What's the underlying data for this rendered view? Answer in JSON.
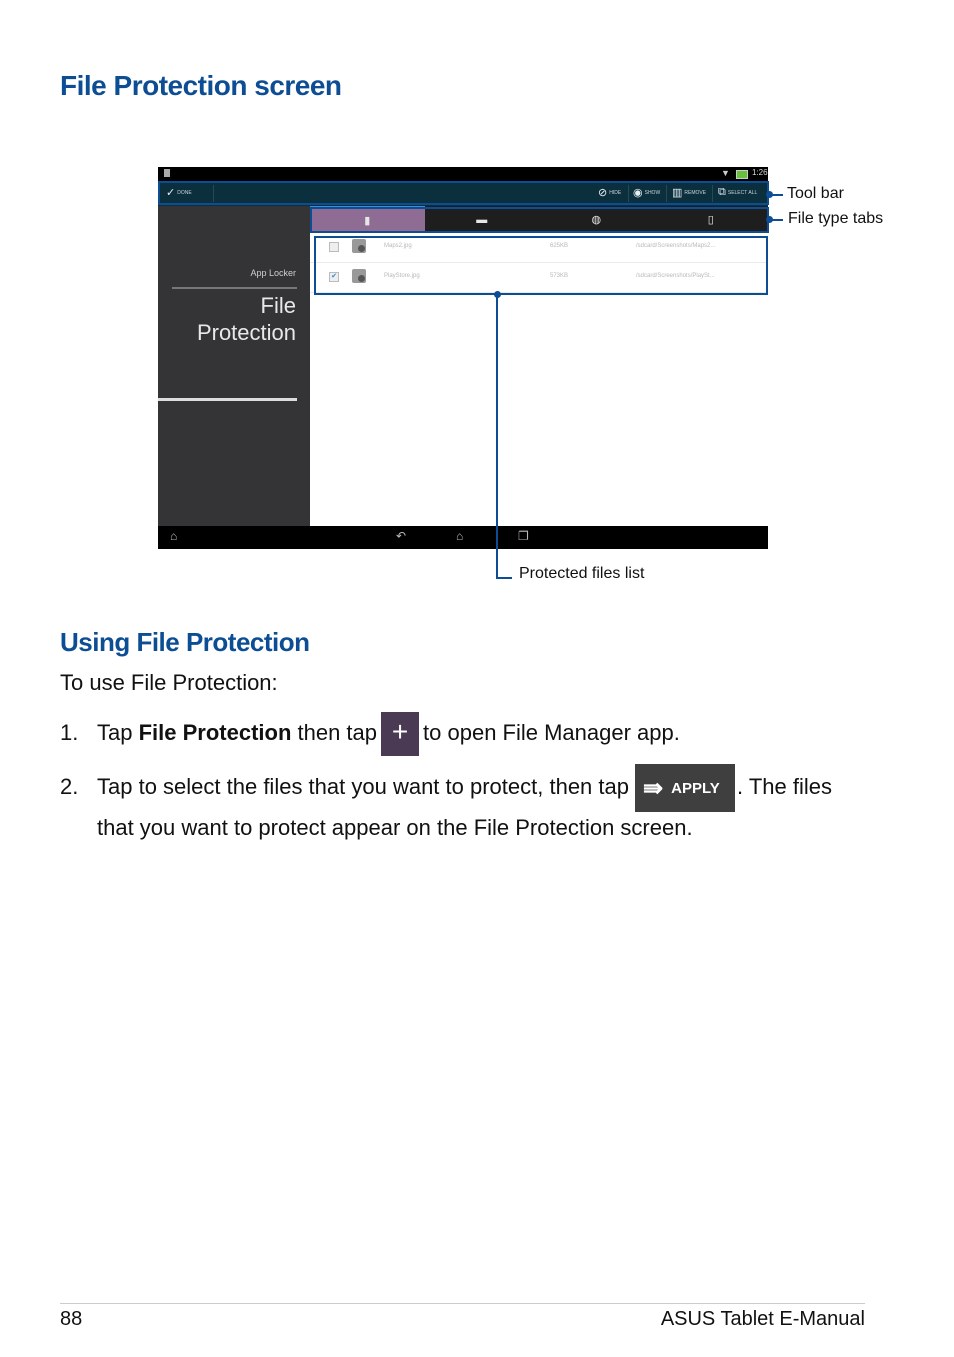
{
  "heading": "File Protection screen",
  "screenshot": {
    "status_bar": {
      "wifi_icon": "wifi-icon",
      "battery_icon": "battery-icon",
      "time": "1:26"
    },
    "toolbar": {
      "done_label": "DONE",
      "hide_label": "HIDE",
      "show_label": "SHOW",
      "remove_label": "REMOVE",
      "select_all_label": "SELECT ALL"
    },
    "sidebar": {
      "parent": "App Locker",
      "title_line1": "File",
      "title_line2": "Protection"
    },
    "tabs": [
      {
        "icon": "document-icon",
        "glyph": "▮",
        "active": true
      },
      {
        "icon": "image-icon",
        "glyph": "▬",
        "active": false
      },
      {
        "icon": "music-icon",
        "glyph": "◍",
        "active": false
      },
      {
        "icon": "file-icon",
        "glyph": "▯",
        "active": false
      }
    ],
    "files": [
      {
        "checked": false,
        "name": "Maps2.jpg",
        "size": "625KB",
        "path": "/sdcard/Screenshots/Maps2..."
      },
      {
        "checked": true,
        "name": "PlayStore.jpg",
        "size": "573KB",
        "path": "/sdcard/Screenshots/PlaySt..."
      }
    ],
    "nav": {
      "menu": "collapse-icon",
      "back": "back-icon",
      "home": "home-icon",
      "recent": "recent-apps-icon"
    }
  },
  "callouts": {
    "toolbar": "Tool bar",
    "file_type_tabs": "File type tabs",
    "protected_files_list": "Protected files list"
  },
  "section2": {
    "heading": "Using File Protection",
    "intro": "To use File Protection:",
    "step1": {
      "num": "1.",
      "pre": "Tap ",
      "bold": "File Protection",
      "mid": " then tap",
      "button": "+",
      "post": "to open File Manager app."
    },
    "step2": {
      "num": "2.",
      "pre": "Tap to select the files that you want to protect, then tap",
      "button": "APPLY",
      "post": ". The files",
      "line2": "that you want to protect appear on the File Protection screen."
    }
  },
  "footer": {
    "page": "88",
    "title": "ASUS Tablet E-Manual"
  }
}
